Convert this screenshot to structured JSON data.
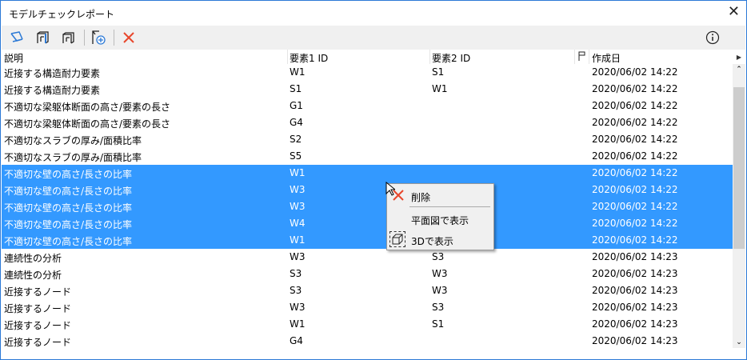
{
  "window": {
    "title": "モデルチェックレポート"
  },
  "toolbar": {
    "icons": [
      "select-in-model-icon",
      "view-plan-icon",
      "view-3d-icon",
      "add-report-icon",
      "delete-icon"
    ],
    "info_icon": "info-icon"
  },
  "columns": [
    "説明",
    "要素1 ID",
    "要素2 ID",
    "作成日"
  ],
  "rows": [
    {
      "desc": "近接する構造耐力要素",
      "e1": "W1",
      "e2": "S1",
      "date": "2020/06/02 14:22",
      "selected": false
    },
    {
      "desc": "近接する構造耐力要素",
      "e1": "S1",
      "e2": "W1",
      "date": "2020/06/02 14:22",
      "selected": false
    },
    {
      "desc": "不適切な梁躯体断面の高さ/要素の長さ",
      "e1": "G1",
      "e2": "",
      "date": "2020/06/02 14:22",
      "selected": false
    },
    {
      "desc": "不適切な梁躯体断面の高さ/要素の長さ",
      "e1": "G4",
      "e2": "",
      "date": "2020/06/02 14:22",
      "selected": false
    },
    {
      "desc": "不適切なスラブの厚み/面積比率",
      "e1": "S2",
      "e2": "",
      "date": "2020/06/02 14:22",
      "selected": false
    },
    {
      "desc": "不適切なスラブの厚み/面積比率",
      "e1": "S5",
      "e2": "",
      "date": "2020/06/02 14:22",
      "selected": false
    },
    {
      "desc": "不適切な壁の高さ/長さの比率",
      "e1": "W1",
      "e2": "",
      "date": "2020/06/02 14:22",
      "selected": true
    },
    {
      "desc": "不適切な壁の高さ/長さの比率",
      "e1": "W3",
      "e2": "",
      "date": "2020/06/02 14:22",
      "selected": true
    },
    {
      "desc": "不適切な壁の高さ/長さの比率",
      "e1": "W3",
      "e2": "",
      "date": "2020/06/02 14:22",
      "selected": true
    },
    {
      "desc": "不適切な壁の高さ/長さの比率",
      "e1": "W4",
      "e2": "",
      "date": "2020/06/02 14:22",
      "selected": true
    },
    {
      "desc": "不適切な壁の高さ/長さの比率",
      "e1": "W1",
      "e2": "",
      "date": "2020/06/02 14:22",
      "selected": true
    },
    {
      "desc": "連続性の分析",
      "e1": "W3",
      "e2": "S3",
      "date": "2020/06/02 14:23",
      "selected": false
    },
    {
      "desc": "連続性の分析",
      "e1": "S3",
      "e2": "W3",
      "date": "2020/06/02 14:23",
      "selected": false
    },
    {
      "desc": "近接するノード",
      "e1": "S3",
      "e2": "W3",
      "date": "2020/06/02 14:23",
      "selected": false
    },
    {
      "desc": "近接するノード",
      "e1": "W3",
      "e2": "S3",
      "date": "2020/06/02 14:23",
      "selected": false
    },
    {
      "desc": "近接するノード",
      "e1": "W1",
      "e2": "S1",
      "date": "2020/06/02 14:23",
      "selected": false
    },
    {
      "desc": "近接するノード",
      "e1": "G4",
      "e2": "",
      "date": "2020/06/02 14:23",
      "selected": false
    }
  ],
  "context_menu": {
    "delete": "削除",
    "show_plan": "平面図で表示",
    "show_3d": "3Dで表示"
  },
  "colors": {
    "accent": "#3399ff",
    "delete": "#e8462b",
    "icon": "#2b79d6"
  }
}
